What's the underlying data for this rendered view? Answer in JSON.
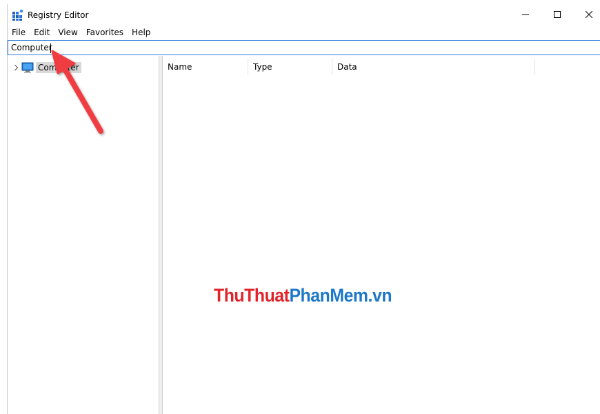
{
  "window": {
    "title": "Registry Editor",
    "accent_color": "#2b7bd4"
  },
  "menu": {
    "items": [
      "File",
      "Edit",
      "View",
      "Favorites",
      "Help"
    ]
  },
  "address_bar": {
    "value": "Computer"
  },
  "tree": {
    "root_label": "Computer"
  },
  "list": {
    "columns": [
      "Name",
      "Type",
      "Data"
    ]
  },
  "watermark": {
    "part_red": "ThuThuat",
    "part_blue": "PhanMem.vn"
  },
  "annotation": {
    "arrow_color": "#ef3e42"
  }
}
